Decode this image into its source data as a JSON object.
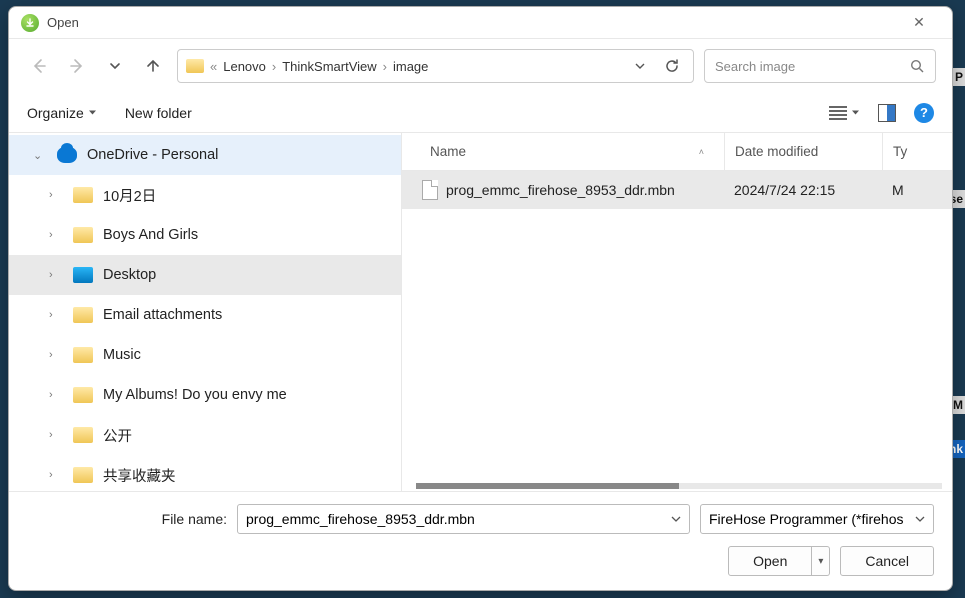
{
  "window": {
    "title": "Open"
  },
  "nav": {
    "breadcrumb_prefix": "«",
    "crumbs": [
      "Lenovo",
      "ThinkSmartView",
      "image"
    ],
    "search_placeholder": "Search image"
  },
  "toolbar": {
    "organize": "Organize",
    "new_folder": "New folder"
  },
  "tree": {
    "items": [
      {
        "label": "OneDrive - Personal",
        "icon": "onedrive",
        "expanded": true,
        "selected": true
      },
      {
        "label": "10月2日",
        "icon": "folder"
      },
      {
        "label": "Boys And Girls",
        "icon": "folder"
      },
      {
        "label": "Desktop",
        "icon": "desktop",
        "hover": true
      },
      {
        "label": "Email attachments",
        "icon": "folder"
      },
      {
        "label": "Music",
        "icon": "folder"
      },
      {
        "label": "My Albums! Do you envy me",
        "icon": "folder"
      },
      {
        "label": "公开",
        "icon": "folder"
      },
      {
        "label": "共享收藏夹",
        "icon": "folder"
      }
    ]
  },
  "file_list": {
    "columns": {
      "name": "Name",
      "date": "Date modified",
      "type": "Ty"
    },
    "sort_indicator": "˄",
    "rows": [
      {
        "name": "prog_emmc_firehose_8953_ddr.mbn",
        "date": "2024/7/24 22:15",
        "type": "M",
        "selected": true
      }
    ]
  },
  "footer": {
    "filename_label": "File name:",
    "filename_value": "prog_emmc_firehose_8953_ddr.mbn",
    "filter_value": "FireHose Programmer (*firehos",
    "open": "Open",
    "cancel": "Cancel"
  },
  "bg_fragments": [
    "P",
    "se",
    "XM",
    "nk"
  ]
}
